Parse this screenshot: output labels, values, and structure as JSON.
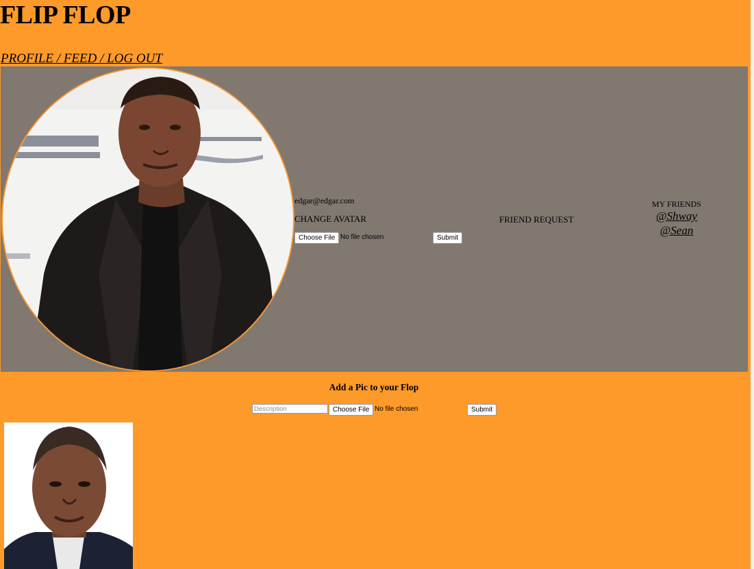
{
  "header": {
    "title": "FLIP FLOP",
    "nav": {
      "profile": "PROFILE",
      "feed": "FEED",
      "logout": "LOG OUT",
      "separator": " / "
    }
  },
  "profile": {
    "avatar_alt": "profile-avatar-photo",
    "email": "edgar@edgar.com",
    "change_avatar_label": "CHANGE AVATAR",
    "choose_file_label": "Choose File",
    "file_status": "No file chosen",
    "submit_label": "Submit",
    "friend_request_label": "FRIEND REQUEST",
    "friends_header": "MY FRIENDS",
    "friends": [
      "@Shway",
      "@Sean"
    ]
  },
  "add_pic": {
    "heading": "Add a Pic to your Flop",
    "description_placeholder": "Description",
    "choose_file_label": "Choose File",
    "file_status": "No file chosen",
    "submit_label": "Submit"
  },
  "colors": {
    "page_background": "#fe9a2a",
    "panel_background": "#817870",
    "avatar_border": "#f49631"
  }
}
